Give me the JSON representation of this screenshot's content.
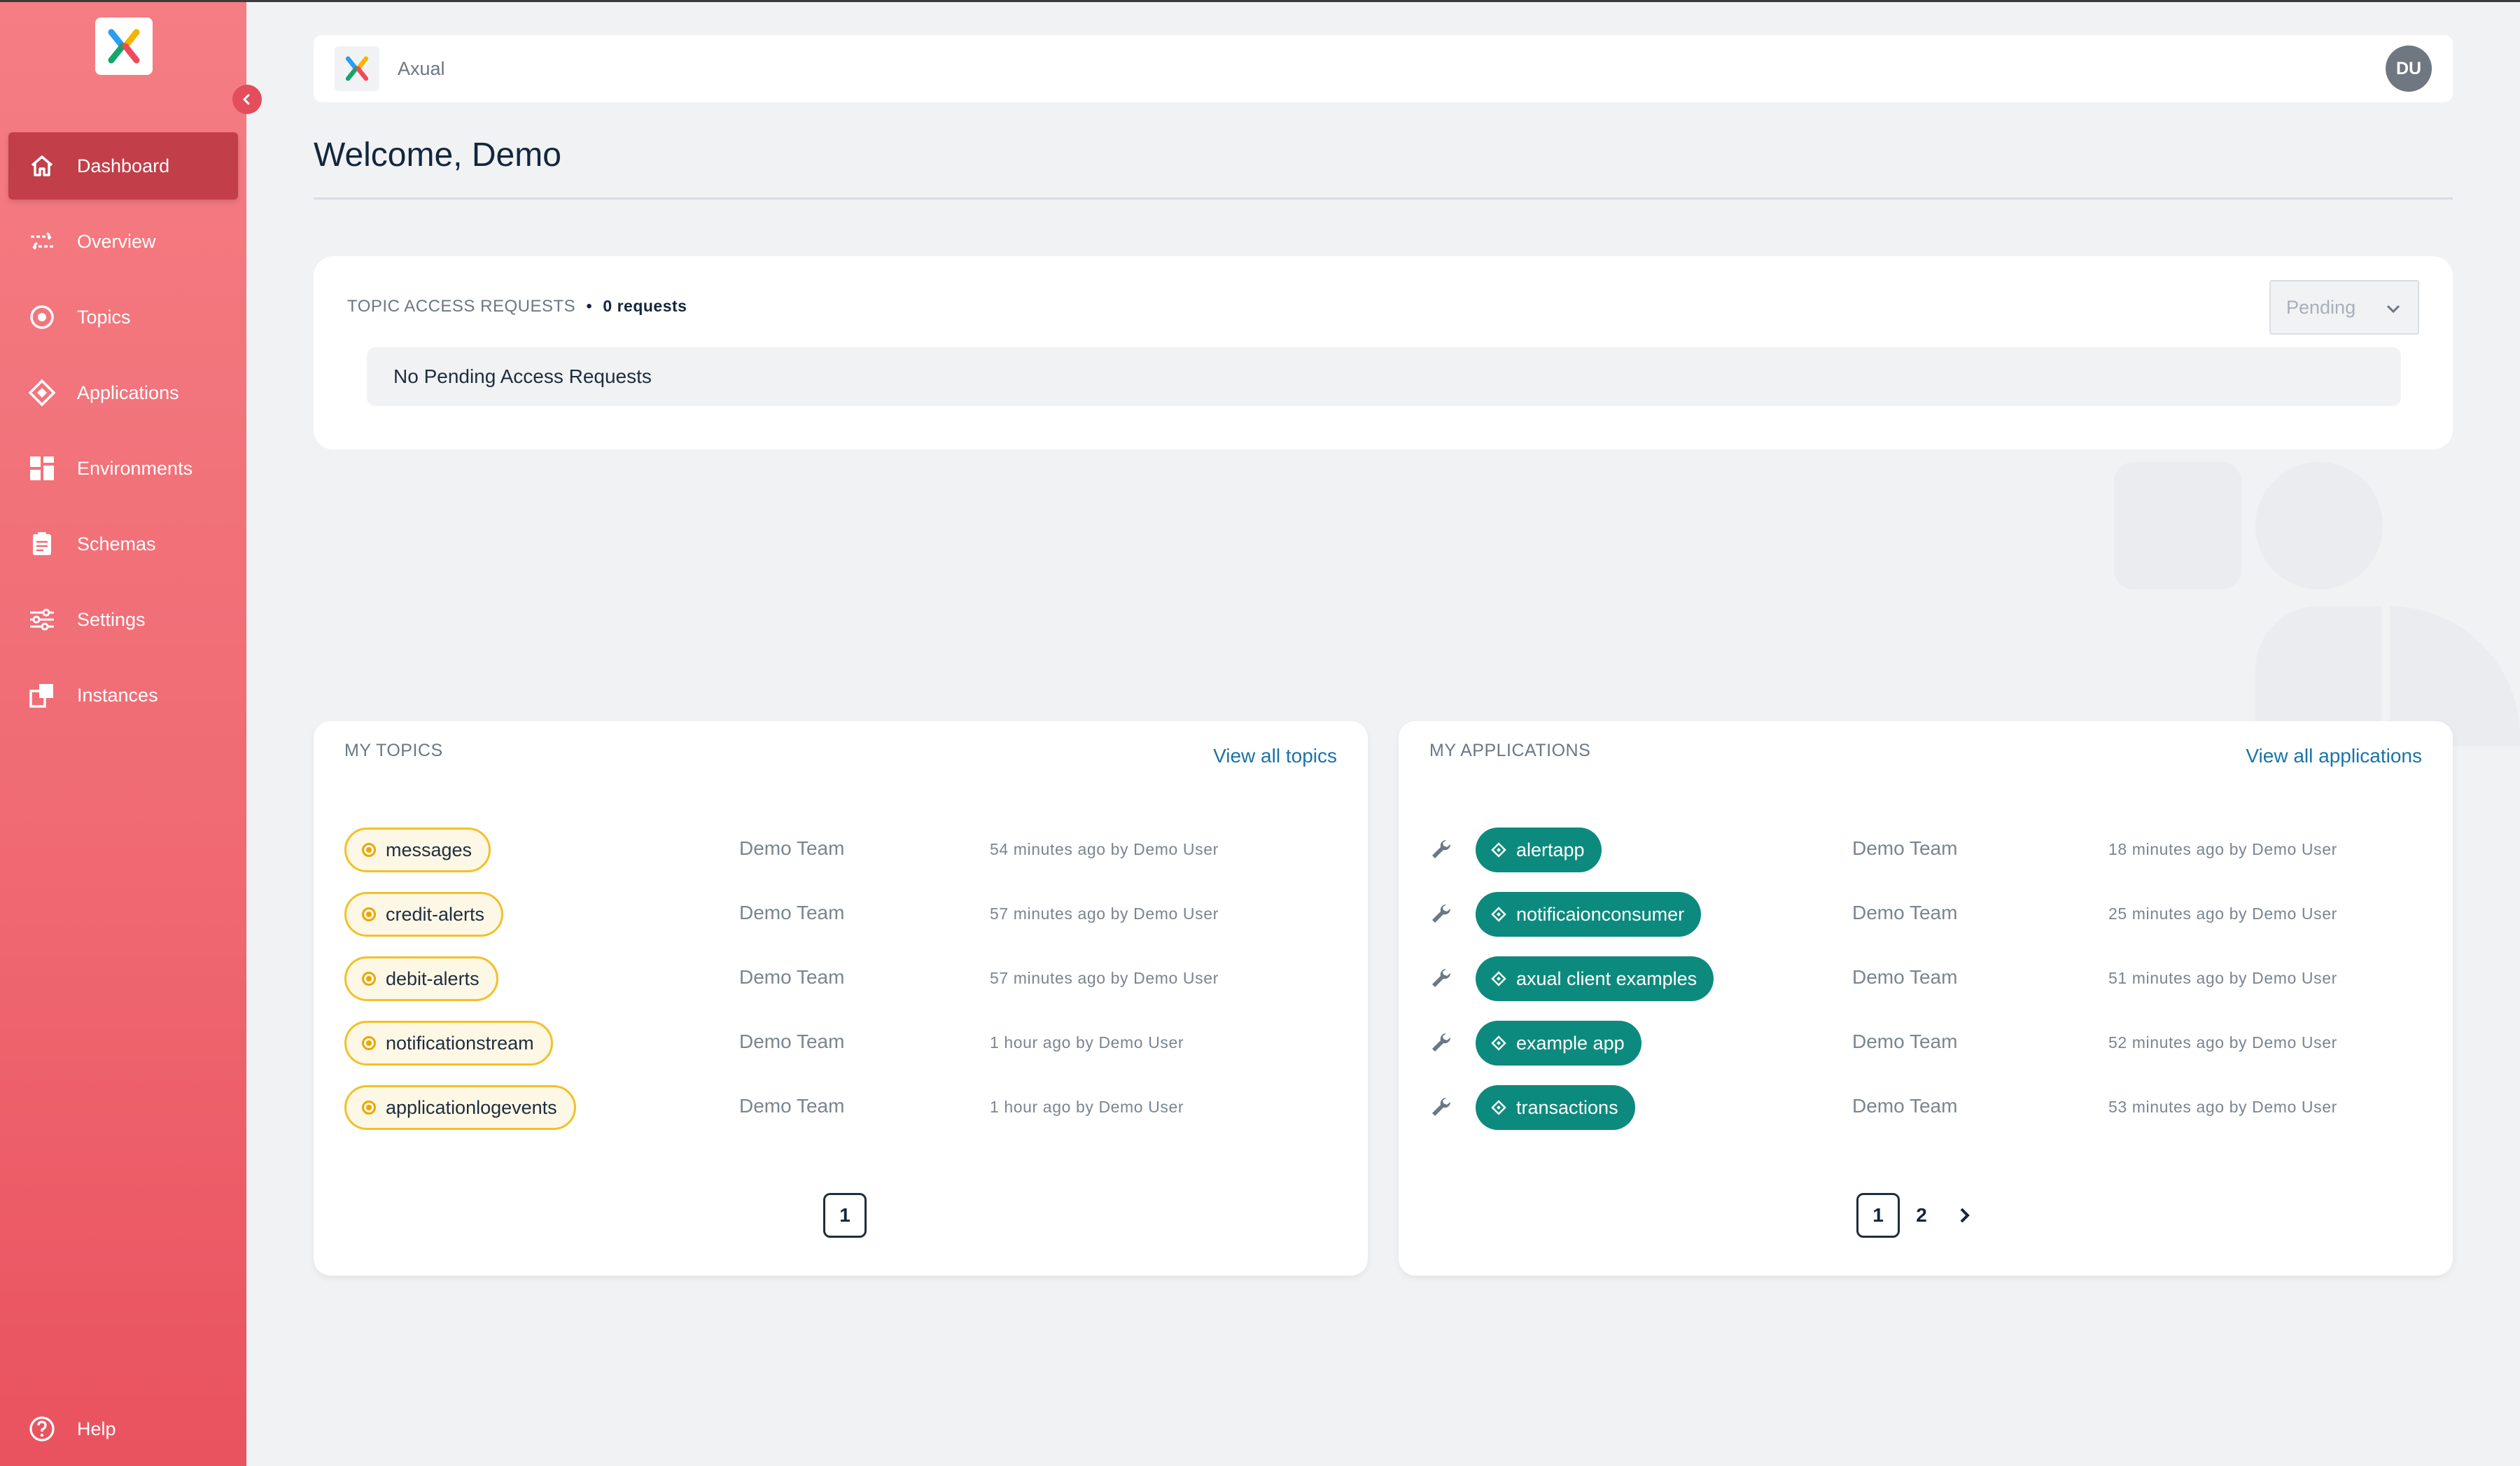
{
  "app": {
    "brand": "Axual"
  },
  "sidebar": {
    "items": [
      {
        "label": "Dashboard",
        "icon": "home-icon",
        "active": true
      },
      {
        "label": "Overview",
        "icon": "flow-arrows-icon"
      },
      {
        "label": "Topics",
        "icon": "target-icon"
      },
      {
        "label": "Applications",
        "icon": "diamond-icon"
      },
      {
        "label": "Environments",
        "icon": "grid-icon"
      },
      {
        "label": "Schemas",
        "icon": "clipboard-icon"
      },
      {
        "label": "Settings",
        "icon": "sliders-icon"
      },
      {
        "label": "Instances",
        "icon": "instances-icon"
      }
    ],
    "help_label": "Help"
  },
  "header": {
    "brand": "Axual",
    "avatar_initials": "DU"
  },
  "welcome": "Welcome, Demo",
  "access_requests": {
    "title": "TOPIC ACCESS REQUESTS",
    "separator": "•",
    "count_label": "0 requests",
    "filter_value": "Pending",
    "empty_message": "No Pending Access Requests"
  },
  "topics": {
    "title": "MY TOPICS",
    "view_all": "View all topics",
    "rows": [
      {
        "name": "messages",
        "team": "Demo Team",
        "updated": "54 minutes ago by Demo User"
      },
      {
        "name": "credit-alerts",
        "team": "Demo Team",
        "updated": "57 minutes ago by Demo User"
      },
      {
        "name": "debit-alerts",
        "team": "Demo Team",
        "updated": "57 minutes ago by Demo User"
      },
      {
        "name": "notificationstream",
        "team": "Demo Team",
        "updated": "1 hour ago by Demo User"
      },
      {
        "name": "applicationlogevents",
        "team": "Demo Team",
        "updated": "1 hour ago by Demo User"
      }
    ],
    "pages": [
      "1"
    ],
    "current_page": "1"
  },
  "applications": {
    "title": "MY APPLICATIONS",
    "view_all": "View all applications",
    "rows": [
      {
        "name": "alertapp",
        "team": "Demo Team",
        "updated": "18 minutes ago by Demo User"
      },
      {
        "name": "notificaionconsumer",
        "team": "Demo Team",
        "updated": "25 minutes ago by Demo User"
      },
      {
        "name": "axual client examples",
        "team": "Demo Team",
        "updated": "51 minutes ago by Demo User"
      },
      {
        "name": "example app",
        "team": "Demo Team",
        "updated": "52 minutes ago by Demo User"
      },
      {
        "name": "transactions",
        "team": "Demo Team",
        "updated": "53 minutes ago by Demo User"
      }
    ],
    "pages": [
      "1",
      "2"
    ],
    "current_page": "1"
  },
  "colors": {
    "sidebar_top": "#f57d83",
    "sidebar_bottom": "#e9525f",
    "active_nav": "#c23e49",
    "topic_chip_border": "#f2c128",
    "app_chip": "#0d8a7e",
    "link": "#1a73a8"
  }
}
